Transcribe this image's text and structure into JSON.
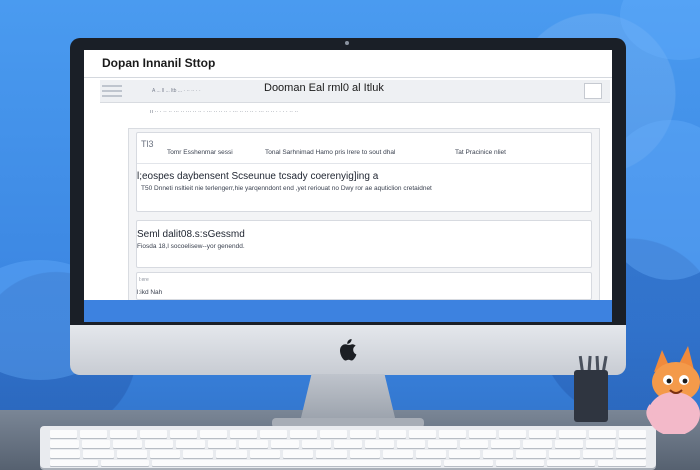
{
  "app": {
    "title": "Dopan Innanil Sttop",
    "header_title": "Dooman Eal rml0 al Itluk",
    "breadcrumb": "A ... ll ... ltb ... · ·· ·· · ·",
    "subnav": "ıı ·· · ·· ·· ··· ·· ··· ·· ·· · ··· ·· ·· ·· · ··· ·· ·· ·· · ··· ·· ·· · · · · ·· ··"
  },
  "card1": {
    "tag": "Tl3",
    "row_a": "Tomr Esshenmar sessi",
    "row_b": "Tonal Sarhnimad Hamo pris lrere to sout dhal",
    "row_c": "Tat Pracinice nliet",
    "heading": "l;eospes daybensent Scseunue tcsady coerenyig]ing a",
    "detail": "T50 Dnneti nsltieit nie terlengerr,hie yarqenndont end ,yet reriouat no Dwy ror ae aquticlion cretaidnet"
  },
  "card2": {
    "heading": "Seml dalit08.s:sGessmd",
    "detail": "Fiosda 18,l socoelisew--yor genendd."
  },
  "card3": {
    "small": "l:ere",
    "label": "l:ikd Nah"
  },
  "colors": {
    "background": "#3f8fe8",
    "screen_accent_bar": "#3d82e0",
    "bezel": "#1a1f27"
  }
}
